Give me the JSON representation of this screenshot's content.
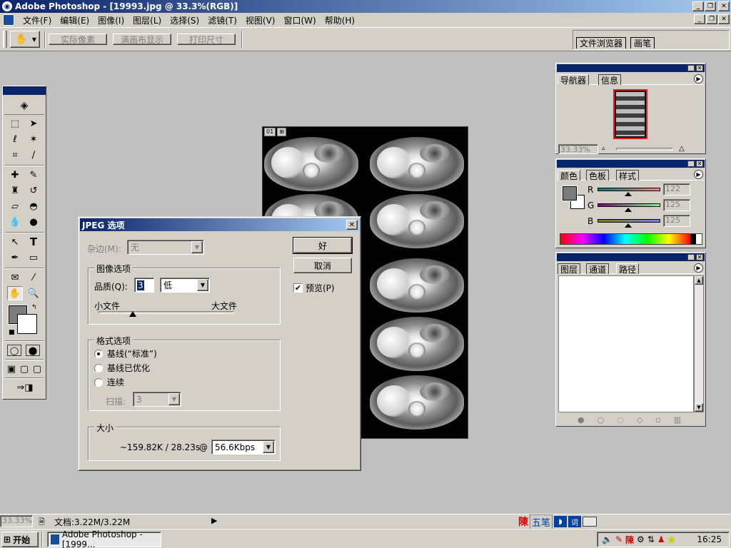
{
  "window": {
    "title": "Adobe Photoshop - [19993.jpg @ 33.3%(RGB)]",
    "min": "_",
    "restore": "❐",
    "close": "✕"
  },
  "menu": [
    "文件(F)",
    "编辑(E)",
    "图像(I)",
    "图层(L)",
    "选择(S)",
    "滤镜(T)",
    "视图(V)",
    "窗口(W)",
    "帮助(H)"
  ],
  "options": {
    "actual_pixels": "实际像素",
    "fit_screen": "满画布显示",
    "print_size": "打印尺寸",
    "tab_file_browser": "文件浏览器",
    "tab_brushes": "画笔"
  },
  "doc": {
    "tag1": "01",
    "tag2": "⊞"
  },
  "jpeg": {
    "title": "JPEG 选项",
    "close": "✕",
    "matte_label": "杂边(M):",
    "matte_value": "无",
    "ok": "好",
    "cancel": "取消",
    "preview_label": "预览(P)",
    "preview_checked": true,
    "image_options_legend": "图像选项",
    "quality_label": "品质(Q):",
    "quality_value": "3",
    "quality_preset": "低",
    "small_file": "小文件",
    "large_file": "大文件",
    "quality_slider_fraction": 0.25,
    "format_legend": "格式选项",
    "format_options": [
      "基线(“标准”)",
      "基线已优化",
      "连续"
    ],
    "format_selected": 0,
    "scans_label": "扫描:",
    "scans_value": "3",
    "size_legend": "大小",
    "size_value": "~159.82K / 28.23s",
    "at": "@",
    "speed": "56.6Kbps"
  },
  "navigator": {
    "tabs": [
      "导航器",
      "信息"
    ],
    "zoom": "33.33%"
  },
  "color": {
    "tabs": [
      "颜色",
      "色板",
      "样式"
    ],
    "r_label": "R",
    "g_label": "G",
    "b_label": "B",
    "r": "122",
    "g": "125",
    "b": "125",
    "fg_hex": "#7a7d7d"
  },
  "layers": {
    "tabs": [
      "图层",
      "通道",
      "路径"
    ]
  },
  "status": {
    "zoom": "33.33%",
    "doc_info": "文档:3.22M/3.22M"
  },
  "ime": {
    "chen": "陳",
    "wubi": "五笔"
  },
  "taskbar": {
    "start": "开始",
    "task": "Adobe Photoshop - [1999...",
    "time": "16:25"
  }
}
